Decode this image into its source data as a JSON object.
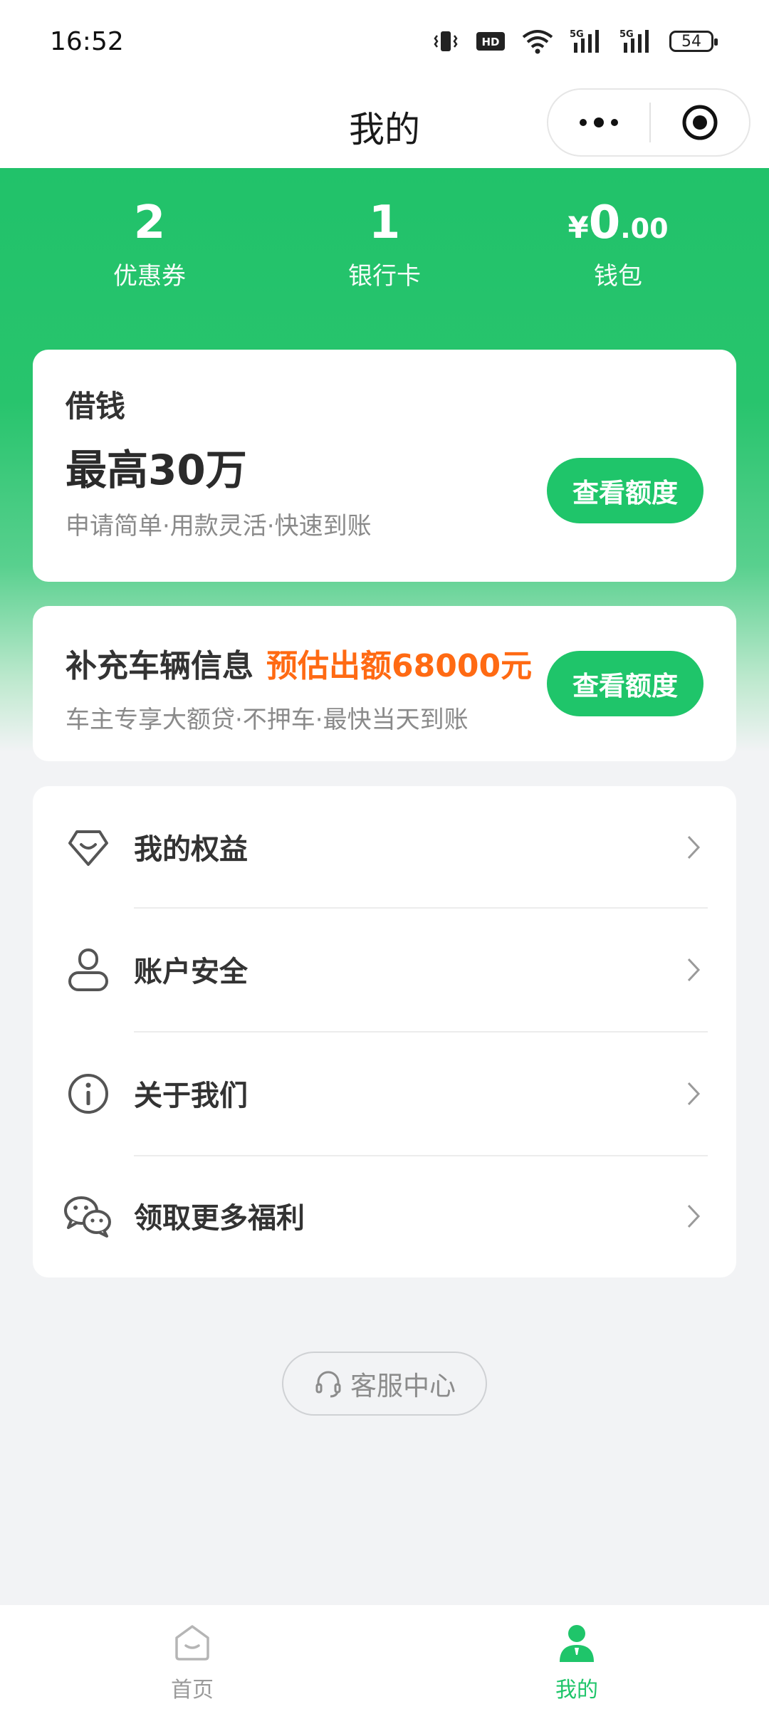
{
  "status_bar": {
    "time": "16:52",
    "battery": "54",
    "icons": [
      "vibrate-icon",
      "hd-icon",
      "wifi-icon",
      "5g-signal-icon",
      "5g-signal-icon",
      "battery-icon"
    ]
  },
  "nav": {
    "title": "我的",
    "more_icon": "more-dots-icon",
    "close_icon": "target-close-icon"
  },
  "stats": [
    {
      "value": "2",
      "label": "优惠券"
    },
    {
      "value": "1",
      "label": "银行卡"
    },
    {
      "currency": "¥",
      "value_int": "0",
      "value_dec": ".00",
      "label": "钱包"
    }
  ],
  "loan_card": {
    "heading": "借钱",
    "amount": "最高30万",
    "description": "申请简单·用款灵活·快速到账",
    "button": "查看额度"
  },
  "car_card": {
    "heading": "补充车辆信息",
    "highlight": "预估出额68000元",
    "description": "车主专享大额贷·不押车·最快当天到账",
    "button": "查看额度"
  },
  "menu": [
    {
      "label": "我的权益",
      "icon": "rights-shield-icon"
    },
    {
      "label": "账户安全",
      "icon": "user-icon"
    },
    {
      "label": "关于我们",
      "icon": "info-icon"
    },
    {
      "label": "领取更多福利",
      "icon": "wechat-icon"
    }
  ],
  "service": {
    "label": "客服中心",
    "icon": "headset-icon"
  },
  "tabs": [
    {
      "label": "首页",
      "icon": "home-icon",
      "active": false
    },
    {
      "label": "我的",
      "icon": "profile-icon",
      "active": true
    }
  ],
  "colors": {
    "brand_green": "#1fc56a",
    "highlight_orange": "#ff6a13",
    "inactive_gray": "#9a9a9a"
  }
}
